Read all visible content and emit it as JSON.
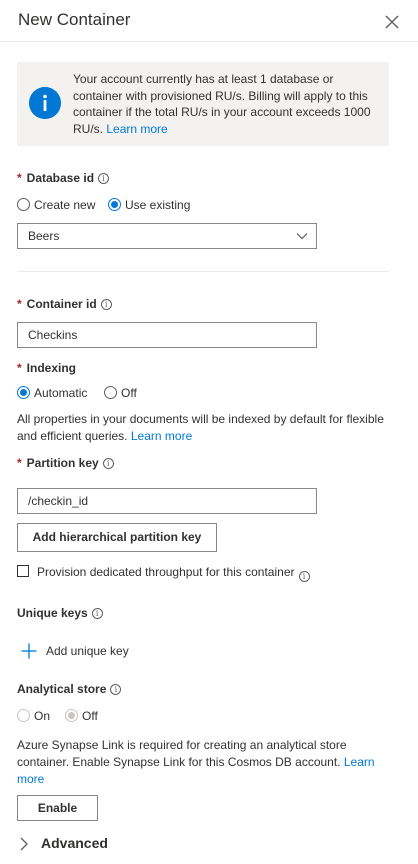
{
  "panel": {
    "title": "New Container",
    "close_icon": "close-icon"
  },
  "info": {
    "text": "Your account currently has at least 1 database or container with provisioned RU/s. Billing will apply to this container if the total RU/s in your account exceeds 1000 RU/s.",
    "link": "Learn more",
    "icon": "info-icon",
    "icon_color": "#0078d4"
  },
  "database": {
    "label": "Database id",
    "required_mark": "*",
    "tip": "i",
    "options": [
      "Create new",
      "Use existing"
    ],
    "selected": "Use existing",
    "select_value": "Beers"
  },
  "container": {
    "label": "Container id",
    "required_mark": "*",
    "tip": "i",
    "value": "Checkins"
  },
  "indexing": {
    "label": "Indexing",
    "required_mark": "*",
    "options": [
      "Automatic",
      "Off"
    ],
    "selected": "Automatic",
    "description": "All properties in your documents will be indexed by default for flexible and efficient queries.",
    "link": "Learn more"
  },
  "partition": {
    "label": "Partition key",
    "required_mark": "*",
    "tip": "i",
    "value": "/checkin_id",
    "hierarchical_button": "Add hierarchical partition key"
  },
  "throughput": {
    "checkbox_label": "Provision dedicated throughput for this container",
    "checked": false,
    "tip": "i"
  },
  "unique_keys": {
    "label": "Unique keys",
    "tip": "i",
    "add_label": "Add unique key"
  },
  "analytical": {
    "label": "Analytical store",
    "tip": "i",
    "options": [
      "On",
      "Off"
    ],
    "selected": "Off",
    "disabled": true,
    "description": "Azure Synapse Link is required for creating an analytical store container. Enable Synapse Link for this Cosmos DB account.",
    "link": "Learn more",
    "enable_button": "Enable"
  },
  "advanced": {
    "label": "Advanced"
  },
  "colors": {
    "accent": "#0078d4",
    "required": "#a4262c",
    "info_bg": "#f3f2f1"
  }
}
